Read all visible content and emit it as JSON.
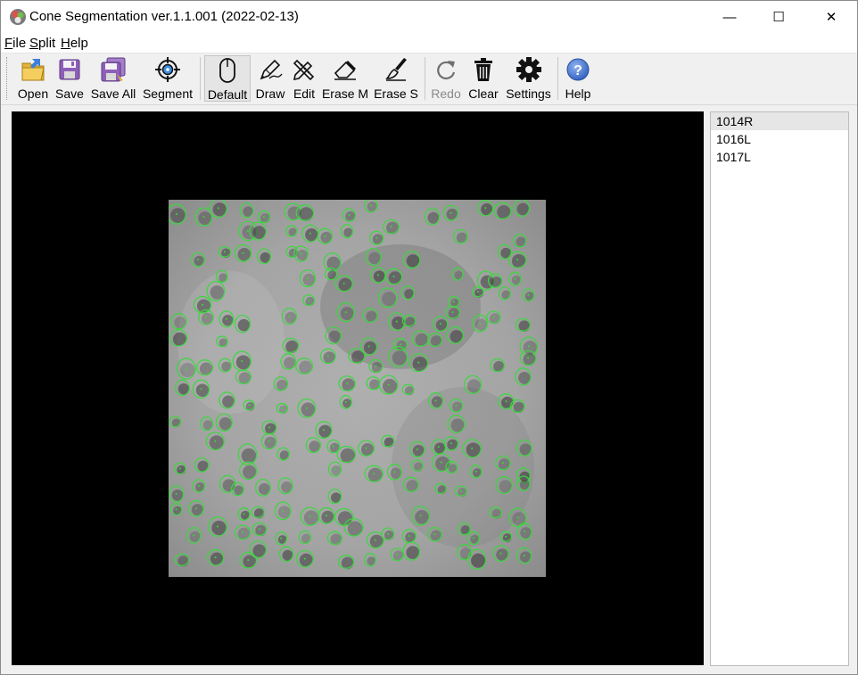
{
  "app": {
    "title": "Cone Segmentation ver.1.1.001 (2022-02-13)"
  },
  "window_controls": {
    "minimize": "—",
    "maximize": "☐",
    "close": "✕"
  },
  "menu": [
    {
      "accel": "F",
      "rest": "ile"
    },
    {
      "accel": "S",
      "rest": "plit"
    },
    {
      "accel": "H",
      "rest": "elp"
    }
  ],
  "toolbar": {
    "open": "Open",
    "save": "Save",
    "save_all": "Save All",
    "segment": "Segment",
    "default": "Default",
    "draw": "Draw",
    "edit": "Edit",
    "erase_m": "Erase M",
    "erase_s": "Erase S",
    "redo": "Redo",
    "clear": "Clear",
    "settings": "Settings",
    "help": "Help",
    "active_tool": "Default",
    "disabled": [
      "Redo"
    ]
  },
  "files": [
    "1014R",
    "1016L",
    "1017L"
  ],
  "selected_file": "1014R",
  "colors": {
    "contour": "#39d93c",
    "viewer_bg": "#000000",
    "help_blue": "#3f6fcf"
  }
}
